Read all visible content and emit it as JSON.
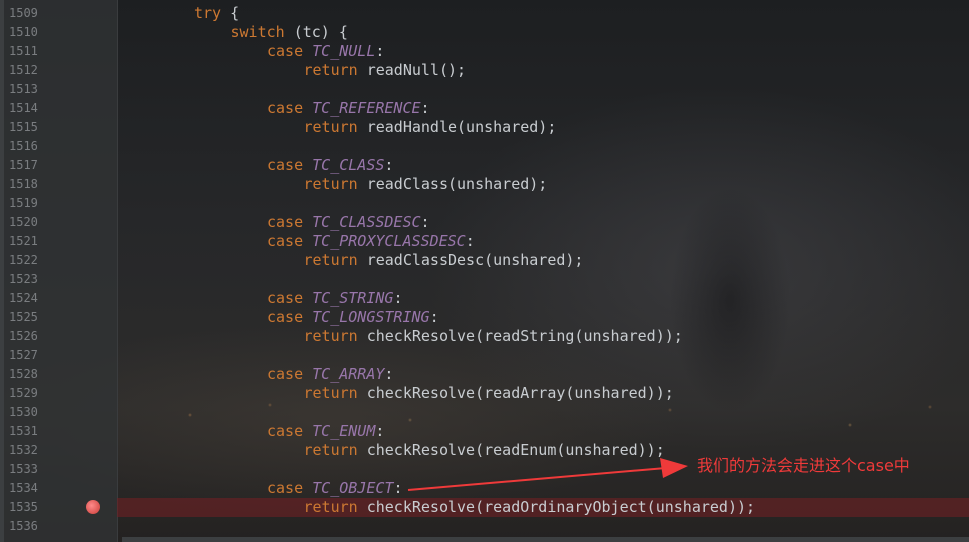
{
  "editor": {
    "lines": [
      {
        "no": "1509",
        "tokens": [
          {
            "t": "try",
            "c": "kw"
          },
          {
            "t": " {",
            "c": "plain"
          }
        ]
      },
      {
        "no": "1510",
        "tokens": [
          {
            "t": "switch",
            "c": "kw"
          },
          {
            "t": " (tc) {",
            "c": "plain"
          }
        ]
      },
      {
        "no": "1511",
        "tokens": [
          {
            "t": "case ",
            "c": "kw"
          },
          {
            "t": "TC_NULL",
            "c": "const"
          },
          {
            "t": ":",
            "c": "plain"
          }
        ]
      },
      {
        "no": "1512",
        "tokens": [
          {
            "t": "return ",
            "c": "kw"
          },
          {
            "t": "readNull();",
            "c": "plain"
          }
        ]
      },
      {
        "no": "1513",
        "tokens": []
      },
      {
        "no": "1514",
        "tokens": [
          {
            "t": "case ",
            "c": "kw"
          },
          {
            "t": "TC_REFERENCE",
            "c": "const"
          },
          {
            "t": ":",
            "c": "plain"
          }
        ]
      },
      {
        "no": "1515",
        "tokens": [
          {
            "t": "return ",
            "c": "kw"
          },
          {
            "t": "readHandle(unshared);",
            "c": "plain"
          }
        ]
      },
      {
        "no": "1516",
        "tokens": []
      },
      {
        "no": "1517",
        "tokens": [
          {
            "t": "case ",
            "c": "kw"
          },
          {
            "t": "TC_CLASS",
            "c": "const"
          },
          {
            "t": ":",
            "c": "plain"
          }
        ]
      },
      {
        "no": "1518",
        "tokens": [
          {
            "t": "return ",
            "c": "kw"
          },
          {
            "t": "readClass(unshared);",
            "c": "plain"
          }
        ]
      },
      {
        "no": "1519",
        "tokens": []
      },
      {
        "no": "1520",
        "tokens": [
          {
            "t": "case ",
            "c": "kw"
          },
          {
            "t": "TC_CLASSDESC",
            "c": "const"
          },
          {
            "t": ":",
            "c": "plain"
          }
        ]
      },
      {
        "no": "1521",
        "tokens": [
          {
            "t": "case ",
            "c": "kw"
          },
          {
            "t": "TC_PROXYCLASSDESC",
            "c": "const"
          },
          {
            "t": ":",
            "c": "plain"
          }
        ]
      },
      {
        "no": "1522",
        "tokens": [
          {
            "t": "return ",
            "c": "kw"
          },
          {
            "t": "readClassDesc(unshared);",
            "c": "plain"
          }
        ]
      },
      {
        "no": "1523",
        "tokens": []
      },
      {
        "no": "1524",
        "tokens": [
          {
            "t": "case ",
            "c": "kw"
          },
          {
            "t": "TC_STRING",
            "c": "const"
          },
          {
            "t": ":",
            "c": "plain"
          }
        ]
      },
      {
        "no": "1525",
        "tokens": [
          {
            "t": "case ",
            "c": "kw"
          },
          {
            "t": "TC_LONGSTRING",
            "c": "const"
          },
          {
            "t": ":",
            "c": "plain"
          }
        ]
      },
      {
        "no": "1526",
        "tokens": [
          {
            "t": "return ",
            "c": "kw"
          },
          {
            "t": "checkResolve(readString(unshared));",
            "c": "plain"
          }
        ]
      },
      {
        "no": "1527",
        "tokens": []
      },
      {
        "no": "1528",
        "tokens": [
          {
            "t": "case ",
            "c": "kw"
          },
          {
            "t": "TC_ARRAY",
            "c": "const"
          },
          {
            "t": ":",
            "c": "plain"
          }
        ]
      },
      {
        "no": "1529",
        "tokens": [
          {
            "t": "return ",
            "c": "kw"
          },
          {
            "t": "checkResolve(readArray(unshared));",
            "c": "plain"
          }
        ]
      },
      {
        "no": "1530",
        "tokens": []
      },
      {
        "no": "1531",
        "tokens": [
          {
            "t": "case ",
            "c": "kw"
          },
          {
            "t": "TC_ENUM",
            "c": "const"
          },
          {
            "t": ":",
            "c": "plain"
          }
        ]
      },
      {
        "no": "1532",
        "tokens": [
          {
            "t": "return ",
            "c": "kw"
          },
          {
            "t": "checkResolve(readEnum(unshared));",
            "c": "plain"
          }
        ]
      },
      {
        "no": "1533",
        "tokens": []
      },
      {
        "no": "1534",
        "tokens": [
          {
            "t": "case ",
            "c": "kw"
          },
          {
            "t": "TC_OBJECT",
            "c": "const"
          },
          {
            "t": ":",
            "c": "plain"
          }
        ]
      },
      {
        "no": "1535",
        "tokens": [
          {
            "t": "return ",
            "c": "kw"
          },
          {
            "t": "checkResolve(readOrdinaryObject(unshared));",
            "c": "plain"
          }
        ],
        "breakpoint": true
      },
      {
        "no": "1536",
        "tokens": []
      }
    ]
  },
  "annotation": {
    "text": "我们的方法会走进这个case中",
    "color": "#ef3a3a"
  },
  "colors": {
    "keyword": "#cc7832",
    "constant": "#9876aa",
    "text": "#c8ccd0",
    "line_number": "#7a7d80",
    "breakpoint": "#d9534f",
    "breakpoint_row": "#6e2024"
  },
  "icons": {
    "breakpoint": "breakpoint-icon"
  }
}
